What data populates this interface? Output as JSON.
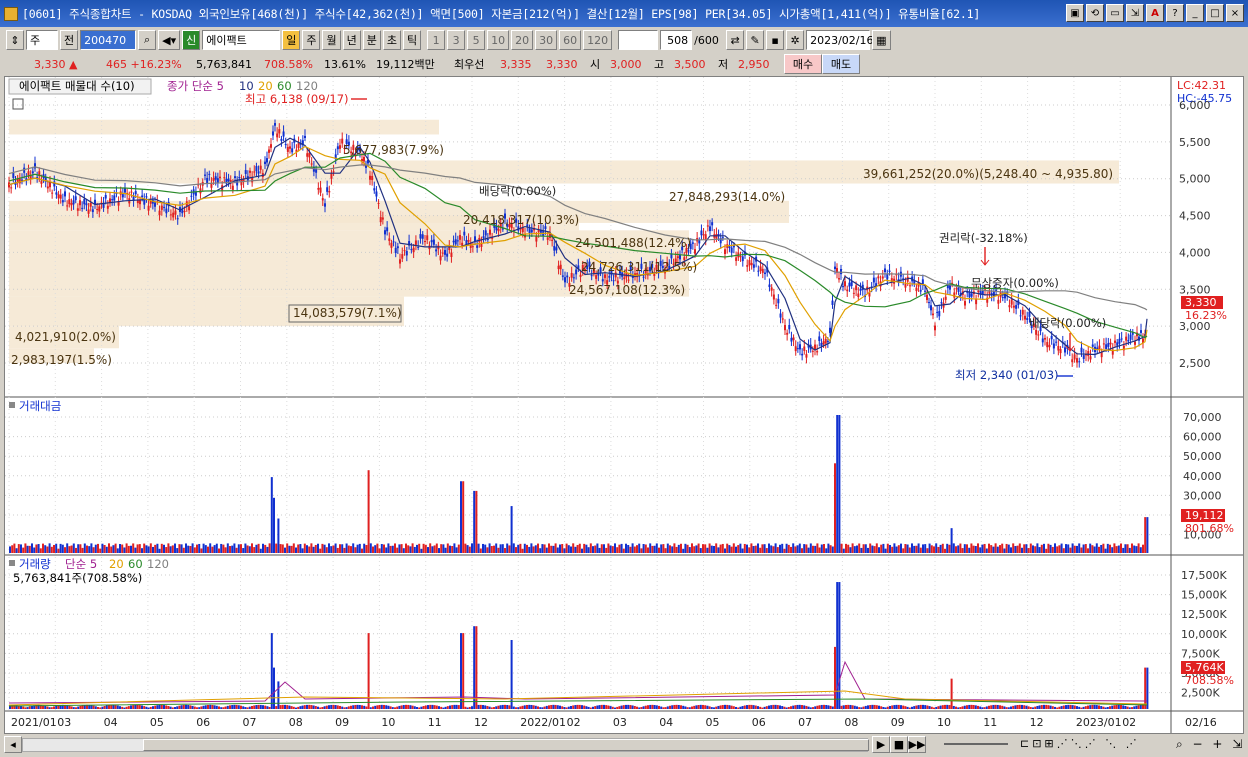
{
  "window": {
    "title": "[0601] 주식종합차트 - KOSDAQ 외국인보유[468(천)] 주식수[42,362(천)] 액면[500] 자본금[212(억)] 결산[12월] EPS[98] PER[34.05] 시가총액[1,411(억)] 유통비율[62.1]",
    "buttons": [
      "▣",
      "⟲",
      "▭",
      "⇲",
      "A",
      "?",
      "_",
      "□",
      "×"
    ]
  },
  "toolbar": {
    "period_unit": "주",
    "prev_label": "전",
    "code": "200470",
    "stock_badge": "신",
    "stock_name": "에이팩트",
    "tabs": [
      "일",
      "주",
      "월",
      "년",
      "분",
      "초",
      "틱"
    ],
    "active_tab": "일",
    "intervals": [
      "1",
      "3",
      "5",
      "10",
      "20",
      "30",
      "60",
      "120"
    ],
    "count": "508",
    "count_total": "/600",
    "date": "2023/02/16"
  },
  "quote": {
    "price": "3,330 ▲",
    "change": "465 +16.23%",
    "volume": "5,763,841",
    "vol_ratio": "708.58%",
    "turnover": "13.61%",
    "amount": "19,112백만",
    "pref_label": "최우선",
    "ask": "3,335",
    "bid": "3,330",
    "open_label": "시",
    "open": "3,000",
    "high_label": "고",
    "high": "3,500",
    "low_label": "저",
    "low": "2,950",
    "buy_label": "매수",
    "sell_label": "매도"
  },
  "price_panel": {
    "legend_title": "에이팩트 매물대 수(10)",
    "ma_legend": "종가 단순 5",
    "ma_periods": [
      "10",
      "20",
      "60",
      "120"
    ],
    "lc": "LC:42.31",
    "hc": "HC:-45.75",
    "high_note": "최고 6,138 (09/17)",
    "low_note": "최저 2,340 (01/03)",
    "price_badge": "3,330",
    "pct_badge": "16.23%",
    "yticks": [
      "6,000",
      "5,500",
      "5,000",
      "4,500",
      "4,000",
      "3,500",
      "3,000",
      "2,500"
    ],
    "volume_profile": [
      {
        "text": "5,677,983(7.9%)"
      },
      {
        "text": "39,661,252(20.0%)(5,248.40 ~ 4,935.80)"
      },
      {
        "text": "27,848,293(14.0%)"
      },
      {
        "text": "20,418,317(10.3%)"
      },
      {
        "text": "24,501,488(12.4%)"
      },
      {
        "text": "24,726,311(12.5%)"
      },
      {
        "text": "24,567,108(12.3%)"
      },
      {
        "text": "14,083,579(7.1%)"
      },
      {
        "text": "4,021,910(2.0%)"
      },
      {
        "text": "2,983,197(1.5%)"
      }
    ],
    "events": [
      "배당락(0.00%)",
      "권리락(-32.18%)",
      "무상증자(0.00%)",
      "배당락(0.00%)"
    ]
  },
  "amount_panel": {
    "title": "거래대금",
    "yticks": [
      "70,000",
      "60,000",
      "50,000",
      "40,000",
      "30,000",
      "20,000",
      "10,000"
    ],
    "badge_value": "19,112",
    "badge_pct": "801.68%"
  },
  "volume_panel": {
    "title": "거래량",
    "ma_label": "단순 5",
    "ma_periods": [
      "20",
      "60",
      "120"
    ],
    "sub": "5,763,841주(708.58%)",
    "yticks": [
      "17,500K",
      "15,000K",
      "12,500K",
      "10,000K",
      "7,500K",
      "5,000K",
      "2,500K"
    ],
    "badge_value": "5,764K",
    "badge_pct": "708.58%"
  },
  "x_axis": [
    "2021/01",
    "03",
    "04",
    "05",
    "06",
    "07",
    "08",
    "09",
    "10",
    "11",
    "12",
    "2022/01",
    "02",
    "03",
    "04",
    "05",
    "06",
    "07",
    "08",
    "09",
    "10",
    "11",
    "12",
    "2023/01",
    "02"
  ],
  "x_end_label": "02/16",
  "colors": {
    "up": "#e02020",
    "down": "#1030d0",
    "band": "#f5e6d0",
    "ma5": "#203080",
    "ma20": "#e0a000",
    "ma60": "#2a8a2a",
    "ma120": "#808080"
  }
}
